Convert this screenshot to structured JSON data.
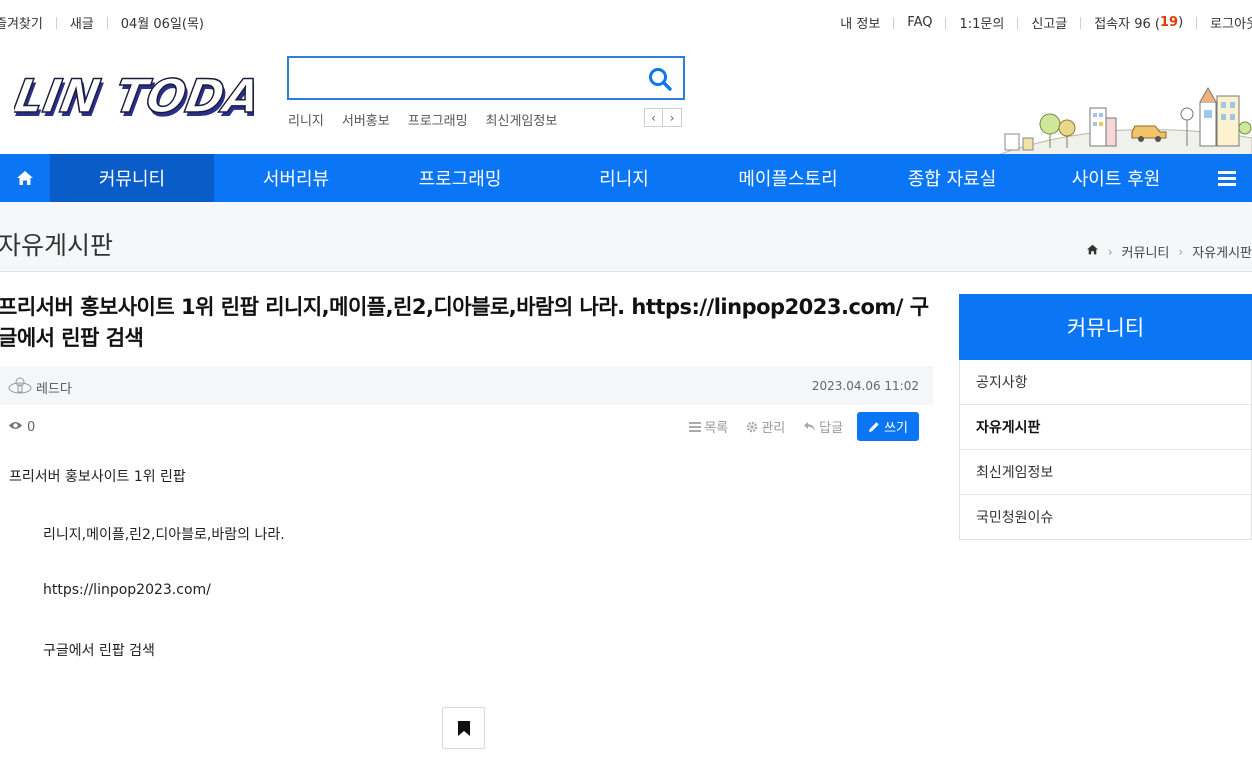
{
  "topbar": {
    "left": [
      "즐겨찾기",
      "새글",
      "04월 06일(목)"
    ],
    "right": {
      "my_info": "내 정보",
      "faq": "FAQ",
      "inquiry": "1:1문의",
      "report": "신고글",
      "visitors_label": "접속자 96 (",
      "visitors_count": "19",
      "visitors_close": ")",
      "logout": "로그아웃"
    }
  },
  "header": {
    "logo_text": "LIN TODAY",
    "search": {
      "value": "",
      "placeholder": ""
    },
    "keywords": [
      "리니지",
      "서버홍보",
      "프로그래밍",
      "최신게임정보"
    ]
  },
  "nav": {
    "items": [
      "커뮤니티",
      "서버리뷰",
      "프로그래밍",
      "리니지",
      "메이플스토리",
      "종합 자료실",
      "사이트 후원"
    ],
    "active_index": 0
  },
  "page": {
    "title": "자유게시판",
    "breadcrumb": [
      "커뮤니티",
      "자유게시판"
    ]
  },
  "post": {
    "title": "프리서버 홍보사이트 1위 린팝 리니지,메이플,린2,디아블로,바람의 나라. https://linpop2023.com/ 구글에서 린팝 검색",
    "author": "레드다",
    "date": "2023.04.06 11:02",
    "views": "0",
    "actions": {
      "list": "목록",
      "manage": "관리",
      "reply": "답글",
      "write": "쓰기"
    },
    "body": [
      "프리서버 홍보사이트 1위 린팝",
      "리니지,메이플,린2,디아블로,바람의 나라.",
      "https://linpop2023.com/",
      "구글에서 린팝 검색"
    ]
  },
  "sidebar": {
    "title": "커뮤니티",
    "items": [
      "공지사항",
      "자유게시판",
      "최신게임정보",
      "국민청원이슈"
    ],
    "active_index": 1
  },
  "colors": {
    "brand_blue": "#0a76f6",
    "nav_active": "#0a5dc9",
    "search_border": "#2f7de1",
    "visitor_count": "#e03b00"
  },
  "icons": [
    "search-icon",
    "home-icon",
    "menu-icon",
    "chevron-left-icon",
    "chevron-right-icon",
    "eye-icon",
    "list-icon",
    "gear-icon",
    "reply-icon",
    "pencil-icon",
    "bookmark-icon",
    "user-icon"
  ]
}
